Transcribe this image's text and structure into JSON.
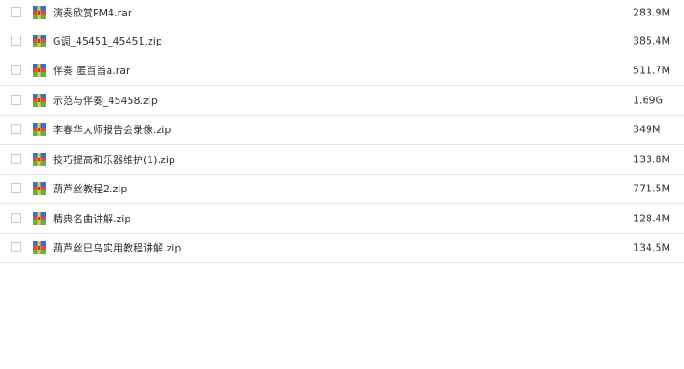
{
  "files": [
    {
      "name": "演奏欣赏PM4.rar",
      "size": "283.9M",
      "icon": "archive-icon"
    },
    {
      "name": "G调_45451_45451.zip",
      "size": "385.4M",
      "icon": "archive-icon"
    },
    {
      "name": "伴奏 匿百首a.rar",
      "size": "511.7M",
      "icon": "archive-icon"
    },
    {
      "name": "示范与伴奏_45458.zip",
      "size": "1.69G",
      "icon": "archive-icon"
    },
    {
      "name": "李春华大师报告会录像.zip",
      "size": "349M",
      "icon": "archive-icon"
    },
    {
      "name": "技巧提高和乐器维护(1).zip",
      "size": "133.8M",
      "icon": "archive-icon"
    },
    {
      "name": "葫芦丝教程2.zip",
      "size": "771.5M",
      "icon": "archive-icon"
    },
    {
      "name": "精典名曲讲解.zip",
      "size": "128.4M",
      "icon": "archive-icon"
    },
    {
      "name": "葫芦丝巴乌实用教程讲解.zip",
      "size": "134.5M",
      "icon": "archive-icon"
    }
  ],
  "colors": {
    "border": "#e6e6e6",
    "checkbox_border": "#c9c9c9",
    "text": "#333333"
  }
}
